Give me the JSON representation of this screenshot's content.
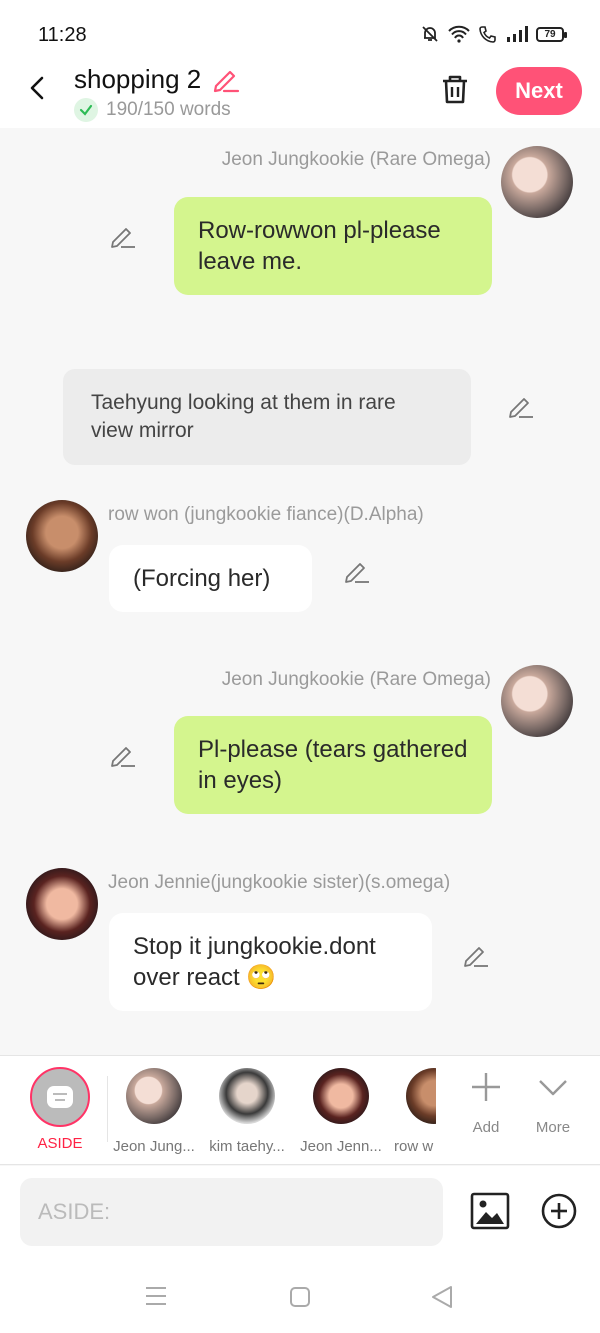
{
  "status": {
    "time": "11:28",
    "battery": "79"
  },
  "header": {
    "title": "shopping 2",
    "word_count": "190/150 words",
    "next_label": "Next"
  },
  "messages": [
    {
      "type": "right",
      "name": "Jeon Jungkookie (Rare Omega)",
      "text": "Row-rowwon pl-please leave me."
    },
    {
      "type": "aside",
      "text": "Taehyung looking at them in rare view mirror"
    },
    {
      "type": "left",
      "name": "row won (jungkookie fiance)(D.Alpha)",
      "text": "(Forcing her)"
    },
    {
      "type": "right",
      "name": "Jeon Jungkookie (Rare Omega)",
      "text": "Pl-please (tears gathered in eyes)"
    },
    {
      "type": "left",
      "name": "Jeon Jennie(jungkookie sister)(s.omega)",
      "text": "Stop it jungkookie.dont over react 🙄"
    }
  ],
  "characters": {
    "aside_label": "ASIDE",
    "items": [
      "Jeon Jung...",
      "kim taehy...",
      "Jeon Jenn...",
      "row w"
    ],
    "add_label": "Add",
    "more_label": "More"
  },
  "input": {
    "placeholder": "ASIDE:"
  }
}
